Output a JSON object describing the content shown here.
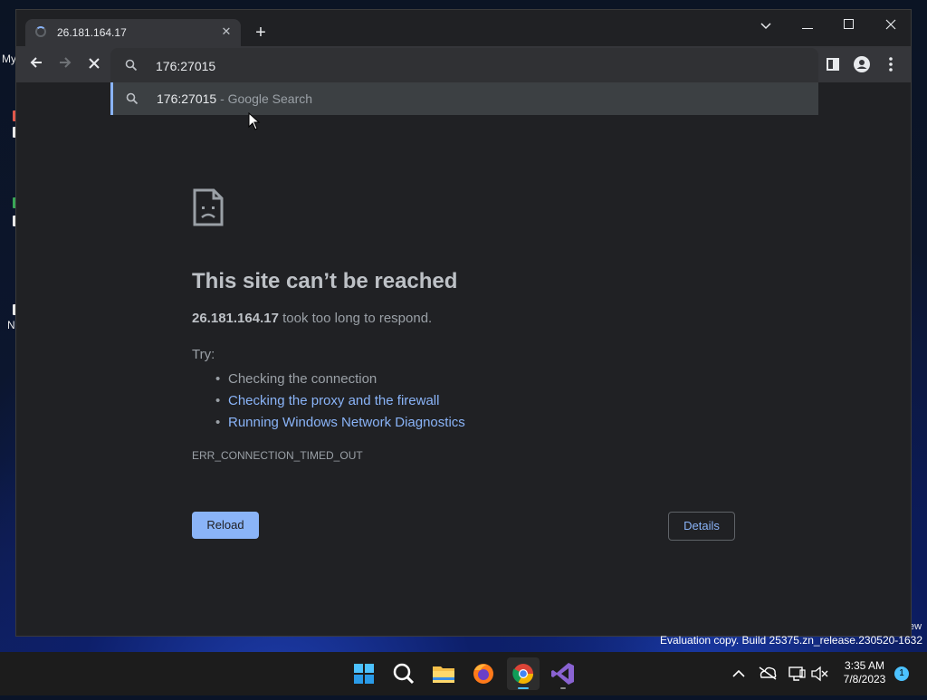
{
  "desktop": {
    "labels": [
      "My",
      "N"
    ],
    "edge_text": "ew"
  },
  "browser": {
    "tab": {
      "title": "26.181.164.17"
    },
    "address": {
      "value": "176:27015"
    },
    "suggestion": {
      "query": "176:27015",
      "suffix": " - Google Search"
    }
  },
  "error_page": {
    "title": "This site can’t be reached",
    "host": "26.181.164.17",
    "message": " took too long to respond.",
    "try_label": "Try:",
    "suggestions": [
      {
        "text": "Checking the connection",
        "link": false
      },
      {
        "text": "Checking the proxy and the firewall",
        "link": true
      },
      {
        "text": "Running Windows Network Diagnostics",
        "link": true
      }
    ],
    "error_code": "ERR_CONNECTION_TIMED_OUT",
    "reload_label": "Reload",
    "details_label": "Details"
  },
  "watermark": "Evaluation copy. Build 25375.zn_release.230520-1632",
  "taskbar": {
    "apps": [
      "windows-start-icon",
      "search-icon",
      "file-explorer-icon",
      "firefox-icon",
      "chrome-icon",
      "visual-studio-icon"
    ],
    "time": "3:35 AM",
    "date": "7/8/2023",
    "notification_count": "1"
  },
  "colors": {
    "accent": "#8ab4f8",
    "page_bg": "#202124",
    "toolbar_bg": "#35363a"
  }
}
